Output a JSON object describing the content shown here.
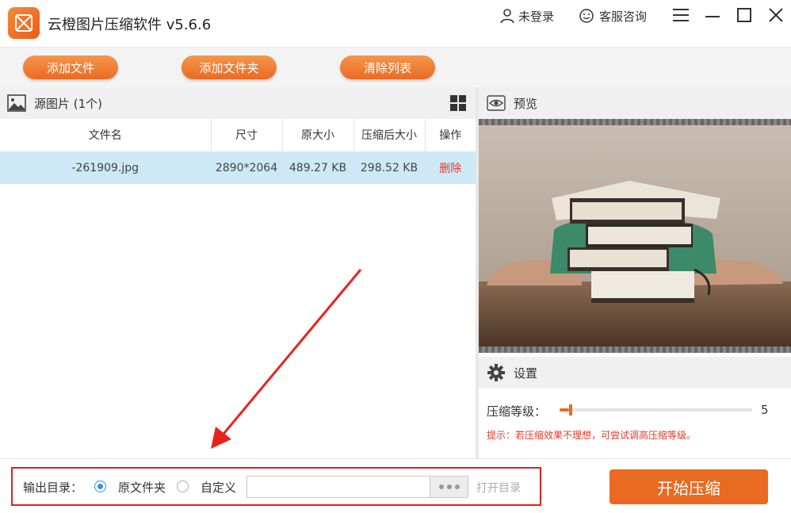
{
  "window": {
    "title": "云橙图片压缩软件 v5.6.6",
    "user_label": "未登录",
    "service_label": "客服咨询"
  },
  "toolbar": {
    "add_file": "添加文件",
    "add_folder": "添加文件夹",
    "clear_list": "清除列表"
  },
  "source": {
    "title": "源图片 (1个)",
    "columns": [
      "文件名",
      "尺寸",
      "原大小",
      "压缩后大小",
      "操作"
    ],
    "rows": [
      {
        "name": "-261909.jpg",
        "size": "2890*2064",
        "original": "489.27 KB",
        "compressed": "298.52 KB",
        "action": "删除"
      }
    ]
  },
  "preview": {
    "title": "预览"
  },
  "settings": {
    "title": "设置",
    "level_label": "压缩等级：",
    "level_value": "5",
    "level_fraction": 0.05,
    "hint": "提示：若压缩效果不理想，可尝试调高压缩等级。"
  },
  "output": {
    "label": "输出目录：",
    "option_original": "原文件夹",
    "option_custom": "自定义",
    "selected": "original",
    "path_value": "",
    "open_dir": "打开目录"
  },
  "start_button": "开始压缩",
  "colors": {
    "accent": "#ea6a22",
    "danger": "#e03a2a",
    "selection": "#cde9f6",
    "radio": "#3a8ee6"
  }
}
